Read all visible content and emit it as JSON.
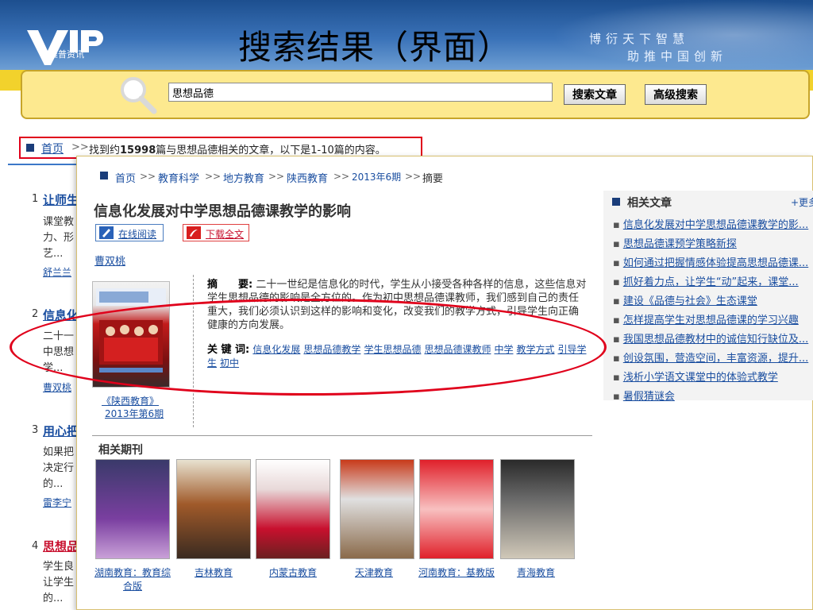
{
  "header": {
    "logo_text": "维普资讯",
    "title": "搜索结果（界面）",
    "slogan_line1": "博衍天下智慧",
    "slogan_line2": "助推中国创新"
  },
  "search": {
    "query": "思想品德",
    "search_button": "搜索文章",
    "advanced_button": "高级搜索"
  },
  "results_bar": {
    "home": "首页",
    "separator": ">>",
    "prefix": "找到约",
    "count": "15998",
    "suffix": "篇与思想品德相关的文章，以下是1-10篇的内容。"
  },
  "results": [
    {
      "num": "1",
      "title": "让师生",
      "lines": [
        "课堂教",
        "力、形",
        "艺..."
      ],
      "author": "舒兰兰",
      "red": false
    },
    {
      "num": "2",
      "title": "信息化",
      "lines": [
        "二十一",
        "中思想",
        "学..."
      ],
      "author": "曹双桃",
      "red": false
    },
    {
      "num": "3",
      "title": "用心把",
      "lines": [
        "如果把",
        "决定行",
        "的..."
      ],
      "author": "雷李宁",
      "red": false
    },
    {
      "num": "4",
      "title": "思想品",
      "lines": [
        "学生良",
        "让学生",
        "的..."
      ],
      "author": "",
      "red": true
    }
  ],
  "article": {
    "breadcrumb": [
      "首页",
      "教育科学",
      "地方教育",
      "陕西教育",
      "2013年6期",
      "摘要"
    ],
    "breadcrumb_sep": ">>",
    "title": "信息化发展对中学思想品德课教学的影响",
    "read_online": "在线阅读",
    "download": "下载全文",
    "author": "曹双桃",
    "cover_caption1": "《陕西教育》",
    "cover_caption2": "2013年第6期",
    "abstract_label": "摘　　要:",
    "abstract_text": "二十一世纪是信息化的时代，学生从小接受各种各样的信息，这些信息对学生思想品德的影响是全方位的。作为初中思想品德课教师，我们感到自己的责任重大，我们必须认识到这样的影响和变化，改变我们的教学方式，引导学生向正确健康的方向发展。",
    "keywords_label": "关 键 词:",
    "keywords": [
      "信息化发展",
      "思想品德教学",
      "学生思想品德",
      "思想品德课教师",
      "中学",
      "教学方式",
      "引导学生",
      "初中"
    ]
  },
  "related_articles": {
    "title": "相关文章",
    "more": "+更多",
    "items": [
      "信息化发展对中学思想品德课教学的影...",
      "思想品德课预学策略新探",
      "如何通过把握情感体验提高思想品德课...",
      "抓好着力点，让学生“动”起来，课堂...",
      "建设《品德与社会》生态课堂",
      "怎样提高学生对思想品德课的学习兴趣",
      "我国思想品德教材中的诚信知行缺位及...",
      "创设氛围，营造空间，丰富资源，提升...",
      "浅析小学语文课堂中的体验式教学",
      "暑假猜谜会"
    ]
  },
  "related_journals": {
    "title": "相关期刊",
    "items": [
      {
        "name1": "湖南教育：教育综",
        "name2": "合版",
        "color": "#7a3fa0"
      },
      {
        "name1": "吉林教育",
        "name2": "",
        "color": "#a05a2a"
      },
      {
        "name1": "内蒙古教育",
        "name2": "",
        "color": "#c8102e"
      },
      {
        "name1": "天津教育",
        "name2": "",
        "color": "#b0401a"
      },
      {
        "name1": "河南教育：基教版",
        "name2": "",
        "color": "#e0202a"
      },
      {
        "name1": "青海教育",
        "name2": "",
        "color": "#2a2a2a"
      }
    ]
  },
  "colors": {
    "link": "#1a4ea0",
    "annotation": "#e0001b",
    "search_panel": "#fde98f"
  }
}
